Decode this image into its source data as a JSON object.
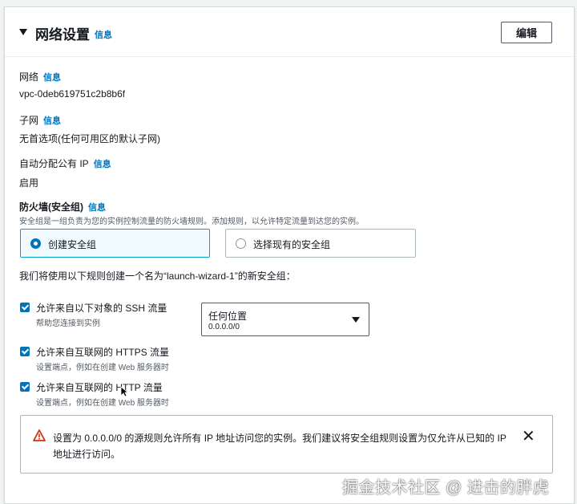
{
  "section": {
    "title": "网络设置",
    "info": "信息",
    "edit_label": "编辑"
  },
  "fields": {
    "network": {
      "label": "网络",
      "info": "信息",
      "value": "vpc-0deb619751c2b8b6f"
    },
    "subnet": {
      "label": "子网",
      "info": "信息",
      "value": "无首选项(任何可用区的默认子网)"
    },
    "public_ip": {
      "label": "自动分配公有 IP",
      "info": "信息",
      "value": "启用"
    }
  },
  "firewall": {
    "label": "防火墙(安全组)",
    "info": "信息",
    "description": "安全组是一组负责为您的实例控制流量的防火墙规则。添加规则，以允许特定流量到达您的实例。",
    "options": [
      {
        "label": "创建安全组",
        "selected": true
      },
      {
        "label": "选择现有的安全组",
        "selected": false
      }
    ],
    "rules_heading": "我们将使用以下规则创建一个名为“launch-wizard-1”的新安全组："
  },
  "rules": [
    {
      "label": "允许来自以下对象的 SSH 流量",
      "desc": "帮助您连接到实例",
      "checked": true
    },
    {
      "label": "允许来自互联网的 HTTPS 流量",
      "desc": "设置端点，例如在创建 Web 服务器时",
      "checked": true
    },
    {
      "label": "允许来自互联网的 HTTP 流量",
      "desc": "设置端点，例如在创建 Web 服务器时",
      "checked": true
    }
  ],
  "ssh_source": {
    "selected": "任何位置",
    "sub": "0.0.0.0/0"
  },
  "alert": {
    "text": "设置为 0.0.0.0/0 的源规则允许所有 IP 地址访问您的实例。我们建议将安全组规则设置为仅允许从已知的 IP 地址进行访问。",
    "close": "✕"
  },
  "watermark": "掘金技术社区 @ 进击的胖虎",
  "colors": {
    "link": "#0073bb",
    "checkbox": "#0073bb",
    "selected_tile_bg": "#f1faff",
    "warning": "#d13212"
  }
}
